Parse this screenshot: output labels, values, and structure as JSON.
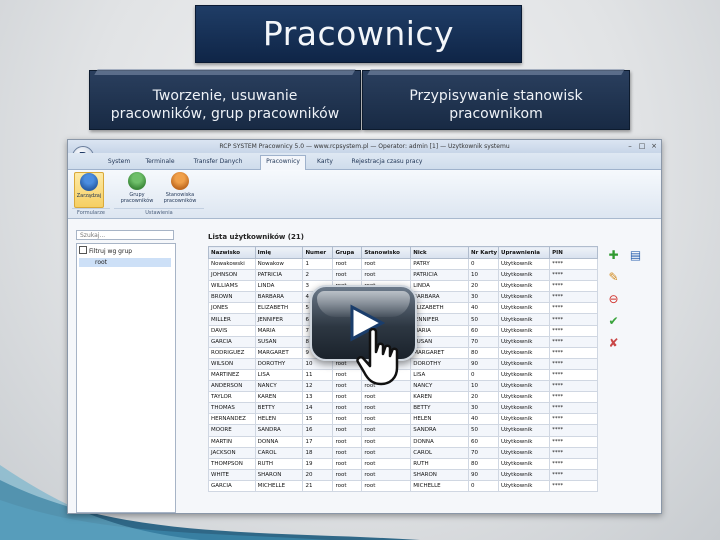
{
  "slide": {
    "title": "Pracownicy",
    "captions": [
      {
        "line1": "Tworzenie, usuwanie",
        "line2": "pracowników, grup pracowników"
      },
      {
        "line1": "Przypisywanie stanowisk",
        "line2": "pracownikom"
      }
    ]
  },
  "app": {
    "window_title": "RCP SYSTEM Pracownicy 5.0 — www.rcpsystem.pl — Operator: admin [1] — Uzytkownik systemu",
    "tabs": [
      "System",
      "Terminale",
      "Transfer Danych",
      "Pracownicy",
      "Karty",
      "Rejestracja czasu pracy"
    ],
    "active_tab": "Pracownicy",
    "ribbon": {
      "buttons": [
        "Zarządzaj",
        "Grupy pracowników",
        "Stanowiska pracowników"
      ],
      "groups": [
        "Formularze",
        "Ustawienia"
      ]
    },
    "search_placeholder": "Szukaj...",
    "filter_label": "Filtruj wg grup",
    "tree_root": "root",
    "list_title": "Lista użytkowników (21)",
    "columns": [
      "Nazwisko",
      "Imię",
      "Numer",
      "Grupa",
      "Stanowisko",
      "Nick",
      "Nr Karty",
      "Uprawnienia",
      "PIN"
    ],
    "rows": [
      [
        "Nowakowski",
        "Nowakow",
        "1",
        "root",
        "root",
        "PATRY",
        "0",
        "Użytkownik",
        "****"
      ],
      [
        "JOHNSON",
        "PATRICIA",
        "2",
        "root",
        "root",
        "PATRICIA",
        "10",
        "Użytkownik",
        "****"
      ],
      [
        "WILLIAMS",
        "LINDA",
        "3",
        "root",
        "root",
        "LINDA",
        "20",
        "Użytkownik",
        "****"
      ],
      [
        "BROWN",
        "BARBARA",
        "4",
        "root",
        "root",
        "BARBARA",
        "30",
        "Użytkownik",
        "****"
      ],
      [
        "JONES",
        "ELIZABETH",
        "5",
        "root",
        "root",
        "ELIZABETH",
        "40",
        "Użytkownik",
        "****"
      ],
      [
        "MILLER",
        "JENNIFER",
        "6",
        "root",
        "root",
        "JENNIFER",
        "50",
        "Użytkownik",
        "****"
      ],
      [
        "DAVIS",
        "MARIA",
        "7",
        "root",
        "root",
        "MARIA",
        "60",
        "Użytkownik",
        "****"
      ],
      [
        "GARCIA",
        "SUSAN",
        "8",
        "root",
        "root",
        "SUSAN",
        "70",
        "Użytkownik",
        "****"
      ],
      [
        "RODRIGUEZ",
        "MARGARET",
        "9",
        "root",
        "root",
        "MARGARET",
        "80",
        "Użytkownik",
        "****"
      ],
      [
        "WILSON",
        "DOROTHY",
        "10",
        "root",
        "root",
        "DOROTHY",
        "90",
        "Użytkownik",
        "****"
      ],
      [
        "MARTINEZ",
        "LISA",
        "11",
        "root",
        "root",
        "LISA",
        "0",
        "Użytkownik",
        "****"
      ],
      [
        "ANDERSON",
        "NANCY",
        "12",
        "root",
        "root",
        "NANCY",
        "10",
        "Użytkownik",
        "****"
      ],
      [
        "TAYLOR",
        "KAREN",
        "13",
        "root",
        "root",
        "KAREN",
        "20",
        "Użytkownik",
        "****"
      ],
      [
        "THOMAS",
        "BETTY",
        "14",
        "root",
        "root",
        "BETTY",
        "30",
        "Użytkownik",
        "****"
      ],
      [
        "HERNANDEZ",
        "HELEN",
        "15",
        "root",
        "root",
        "HELEN",
        "40",
        "Użytkownik",
        "****"
      ],
      [
        "MOORE",
        "SANDRA",
        "16",
        "root",
        "root",
        "SANDRA",
        "50",
        "Użytkownik",
        "****"
      ],
      [
        "MARTIN",
        "DONNA",
        "17",
        "root",
        "root",
        "DONNA",
        "60",
        "Użytkownik",
        "****"
      ],
      [
        "JACKSON",
        "CAROL",
        "18",
        "root",
        "root",
        "CAROL",
        "70",
        "Użytkownik",
        "****"
      ],
      [
        "THOMPSON",
        "RUTH",
        "19",
        "root",
        "root",
        "RUTH",
        "80",
        "Użytkownik",
        "****"
      ],
      [
        "WHITE",
        "SHARON",
        "20",
        "root",
        "root",
        "SHARON",
        "90",
        "Użytkownik",
        "****"
      ],
      [
        "GARCIA",
        "MICHELLE",
        "21",
        "root",
        "root",
        "MICHELLE",
        "0",
        "Użytkownik",
        "****"
      ]
    ]
  },
  "colors": {
    "title_bg": "#1a355c",
    "caption_bg": "#22364f",
    "selection": "#cde0f7"
  },
  "icons": [
    "add-icon",
    "export-icon",
    "edit-icon",
    "delete-icon",
    "check-icon",
    "cancel-icon",
    "play-icon",
    "hand-cursor-icon"
  ]
}
